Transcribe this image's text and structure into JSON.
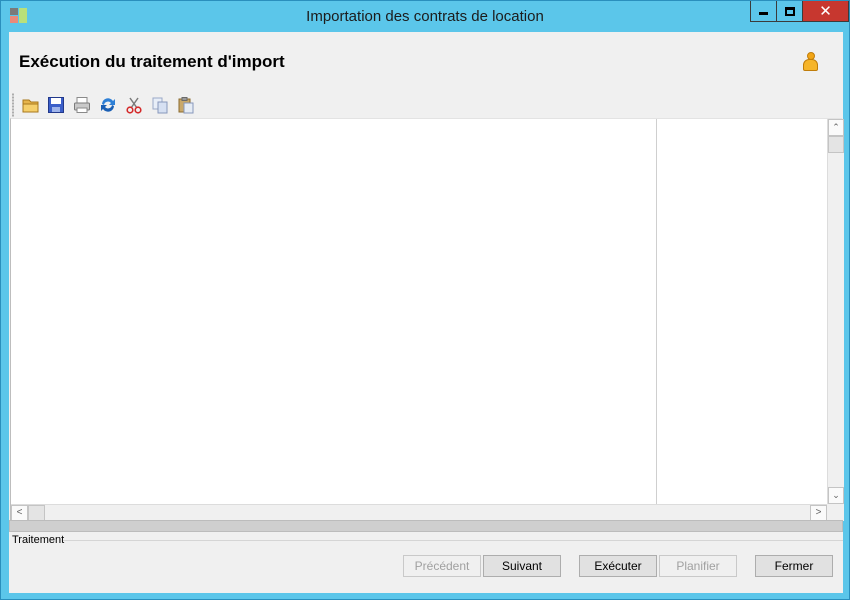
{
  "window": {
    "title": "Importation des contrats de location",
    "controls": {
      "minimize": "",
      "maximize": "",
      "close": "✕"
    }
  },
  "header": {
    "page_title": "Exécution du traitement d'import",
    "user_icon": "user-icon"
  },
  "toolbar": {
    "icons": [
      "folder-open-icon",
      "save-icon",
      "print-icon",
      "refresh-icon",
      "cut-icon",
      "copy-icon",
      "paste-icon"
    ]
  },
  "scrollbars": {
    "up": "⌃",
    "down": "⌄",
    "left": "<",
    "right": ">"
  },
  "group": {
    "label": "Traitement"
  },
  "buttons": {
    "previous": "Précédent",
    "next": "Suivant",
    "execute": "Exécuter",
    "schedule": "Planifier",
    "close": "Fermer"
  },
  "colors": {
    "titlebar": "#5bc6ea",
    "close_button": "#c7372f",
    "client_bg": "#f0f0f0"
  }
}
